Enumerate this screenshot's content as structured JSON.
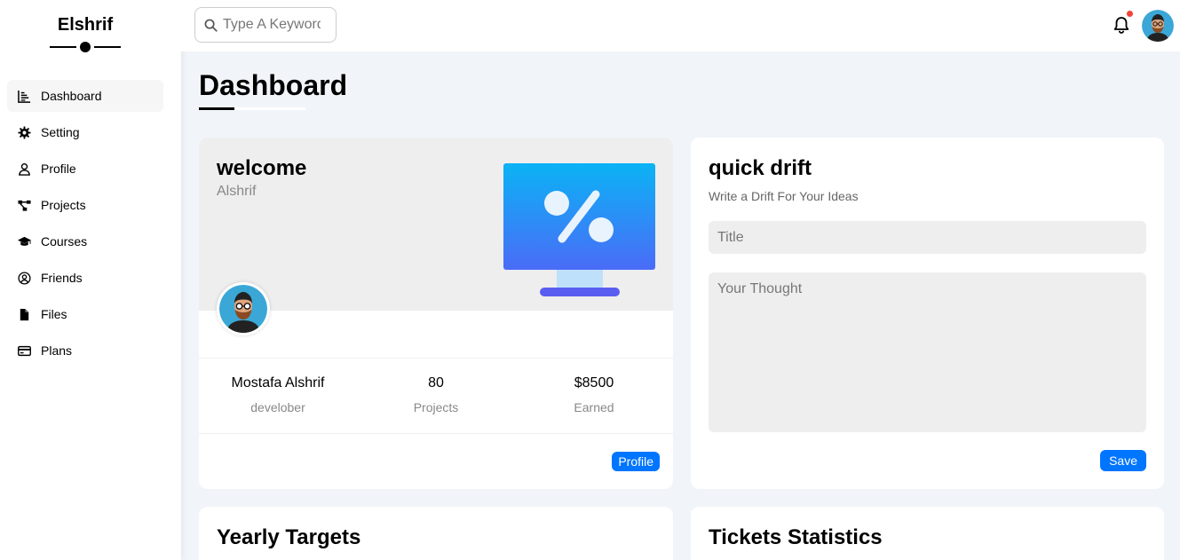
{
  "brand": {
    "name": "Elshrif"
  },
  "sidebar": {
    "items": [
      {
        "label": "Dashboard",
        "icon": "chart-icon",
        "active": true
      },
      {
        "label": "Setting",
        "icon": "gear-icon"
      },
      {
        "label": "Profile",
        "icon": "user-icon"
      },
      {
        "label": "Projects",
        "icon": "diagram-icon"
      },
      {
        "label": "Courses",
        "icon": "graduation-cap-icon"
      },
      {
        "label": "Friends",
        "icon": "user-circle-icon"
      },
      {
        "label": "Files",
        "icon": "file-icon"
      },
      {
        "label": "Plans",
        "icon": "credit-card-icon"
      }
    ]
  },
  "header": {
    "search_placeholder": "Type A Keyword",
    "notification_dot_color": "#f44336"
  },
  "page": {
    "title": "Dashboard"
  },
  "welcome": {
    "title": "welcome",
    "name": "Alshrif",
    "stats": [
      {
        "value": "Mostafa Alshrif",
        "label": "develober"
      },
      {
        "value": "80",
        "label": "Projects"
      },
      {
        "value": "$8500",
        "label": "Earned"
      }
    ],
    "button": "Profile"
  },
  "drift": {
    "title": "quick drift",
    "subtitle": "Write a Drift For Your Ideas",
    "title_placeholder": "Title",
    "thought_placeholder": "Your Thought",
    "button": "Save"
  },
  "sections": {
    "targets_title": "Yearly Targets",
    "tickets_title": "Tickets Statistics"
  },
  "colors": {
    "accent": "#0075ff",
    "background": "#f1f5f9"
  }
}
